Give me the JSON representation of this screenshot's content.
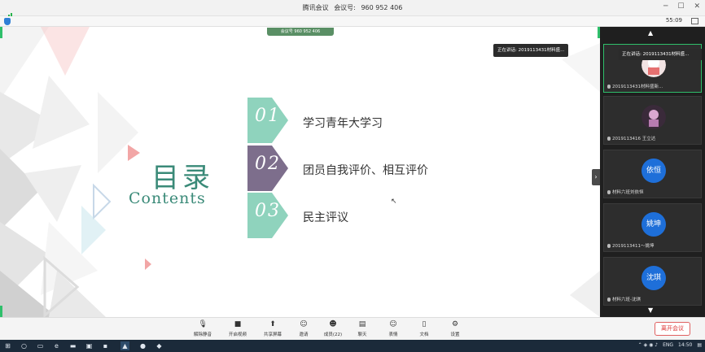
{
  "window": {
    "title_app": "腾讯会议",
    "title_meeting_label": "会议号:",
    "title_meeting_id": "960 952 406",
    "clock": "55:09"
  },
  "slide": {
    "meeting_tab": "会议号 960 952 406",
    "speaking_tip": "正在讲话: 2019113431材料盛...",
    "toc_title": "目录",
    "toc_subtitle": "Contents",
    "items": [
      {
        "num": "01",
        "label": "学习青年大学习",
        "color": "#8fd3bd"
      },
      {
        "num": "02",
        "label": "团员自我评价、相互评价",
        "color": "#7d6e8c"
      },
      {
        "num": "03",
        "label": "民主评议",
        "color": "#8fd3bd"
      }
    ]
  },
  "panel": {
    "speaking_badge": "正在讲话: 2019113431材料盛...",
    "participants": [
      {
        "name": "2019113431材料盛新...",
        "initials": "",
        "type": "photo1",
        "active": true
      },
      {
        "name": "2019113416 王立达",
        "initials": "",
        "type": "photo2",
        "active": false
      },
      {
        "name": "材料六班刘依恒",
        "initials": "依恒",
        "type": "initials",
        "active": false
      },
      {
        "name": "2019113411～姚坤",
        "initials": "姚坤",
        "type": "initials",
        "active": false
      },
      {
        "name": "材料六班-沈琪",
        "initials": "沈琪",
        "type": "initials",
        "active": false
      }
    ]
  },
  "toolbar": {
    "mute": "解除静音",
    "video": "开启视频",
    "share": "共享屏幕",
    "invite": "邀请",
    "members": "成员(22)",
    "chat": "聊天",
    "emoji": "表情",
    "docs": "文档",
    "settings": "设置",
    "leave": "离开会议"
  },
  "taskbar": {
    "language": "ENG",
    "time": "14:50"
  }
}
